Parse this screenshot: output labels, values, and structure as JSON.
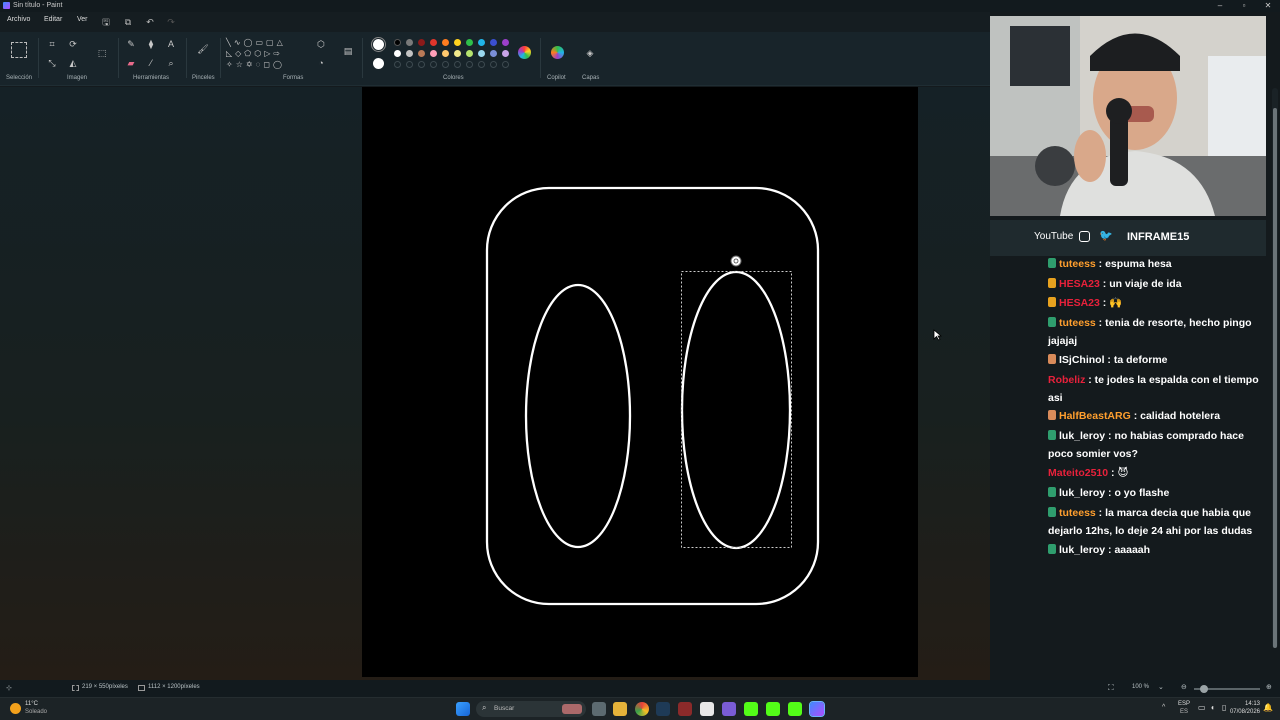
{
  "window": {
    "title": "Sin título - Paint"
  },
  "menu": {
    "file": "Archivo",
    "edit": "Editar",
    "view": "Ver"
  },
  "ribbon": {
    "groups": {
      "selection": "Selección",
      "image": "Imagen",
      "tools": "Herramientas",
      "brushes": "Pinceles",
      "shapes": "Formas",
      "colors": "Colores",
      "copilot": "Copilot",
      "layers": "Capas"
    },
    "palette": [
      "#000000",
      "#7a7a7a",
      "#8b1a1a",
      "#e0352b",
      "#ff7c1f",
      "#ffd21f",
      "#2fbf4a",
      "#20b4e8",
      "#3a4fd0",
      "#9b3fc9",
      "#ffffff",
      "#c3c3c3",
      "#b97a57",
      "#ff9fb8",
      "#ffc86e",
      "#f2ea8c",
      "#b6e36e",
      "#9ad8ef",
      "#7a8fd8",
      "#c8a4e8"
    ]
  },
  "status": {
    "selection_size": "219 × 550píxeles",
    "canvas_size": "1112 × 1200píxeles",
    "zoom": "100 %"
  },
  "stream": {
    "social_youtube": "YouTube",
    "channel": "INFRAME15"
  },
  "chat": [
    {
      "user": "tuteess",
      "color": "#ff9f2e",
      "badge": "#2f9e6e",
      "text": ": espuma hesa"
    },
    {
      "user": "HESA23",
      "color": "#e8213b",
      "badge": "#e8a21f",
      "text": ": un viaje de ida"
    },
    {
      "user": "HESA23",
      "color": "#e8213b",
      "badge": "#e8a21f",
      "text": ": 🙌"
    },
    {
      "user": "tuteess",
      "color": "#ff9f2e",
      "badge": "#2f9e6e",
      "text": ": tenia de resorte, hecho pingo jajajaj"
    },
    {
      "user": "ISjChinol",
      "color": "#ffffff",
      "badge": "#d98b5a",
      "text": ": ta deforme"
    },
    {
      "user": "Robeliz",
      "color": "#e8213b",
      "badge": "",
      "text": ": te jodes la espalda con el tiempo asi"
    },
    {
      "user": "HalfBeastARG",
      "color": "#ff9f2e",
      "badge": "#d98b5a",
      "text": ": calidad hotelera"
    },
    {
      "user": "luk_leroy",
      "color": "#ffffff",
      "badge": "#2f9e6e",
      "text": ": no habias comprado hace poco somier vos?"
    },
    {
      "user": "Mateito2510",
      "color": "#e8213b",
      "badge": "",
      "text": ": 😈"
    },
    {
      "user": "luk_leroy",
      "color": "#ffffff",
      "badge": "#2f9e6e",
      "text": ": o yo flashe"
    },
    {
      "user": "tuteess",
      "color": "#ff9f2e",
      "badge": "#2f9e6e",
      "text": ": la marca decia que habia que dejarlo 12hs, lo deje 24 ahi por las dudas"
    },
    {
      "user": "luk_leroy",
      "color": "#ffffff",
      "badge": "#2f9e6e",
      "text": ": aaaaah"
    }
  ],
  "taskbar": {
    "weather_temp": "11°C",
    "weather_desc": "Soleado",
    "search_placeholder": "Buscar",
    "lang": "ESP",
    "lang_sub": "ES",
    "time": "14:13",
    "date": "07/08/2026"
  }
}
